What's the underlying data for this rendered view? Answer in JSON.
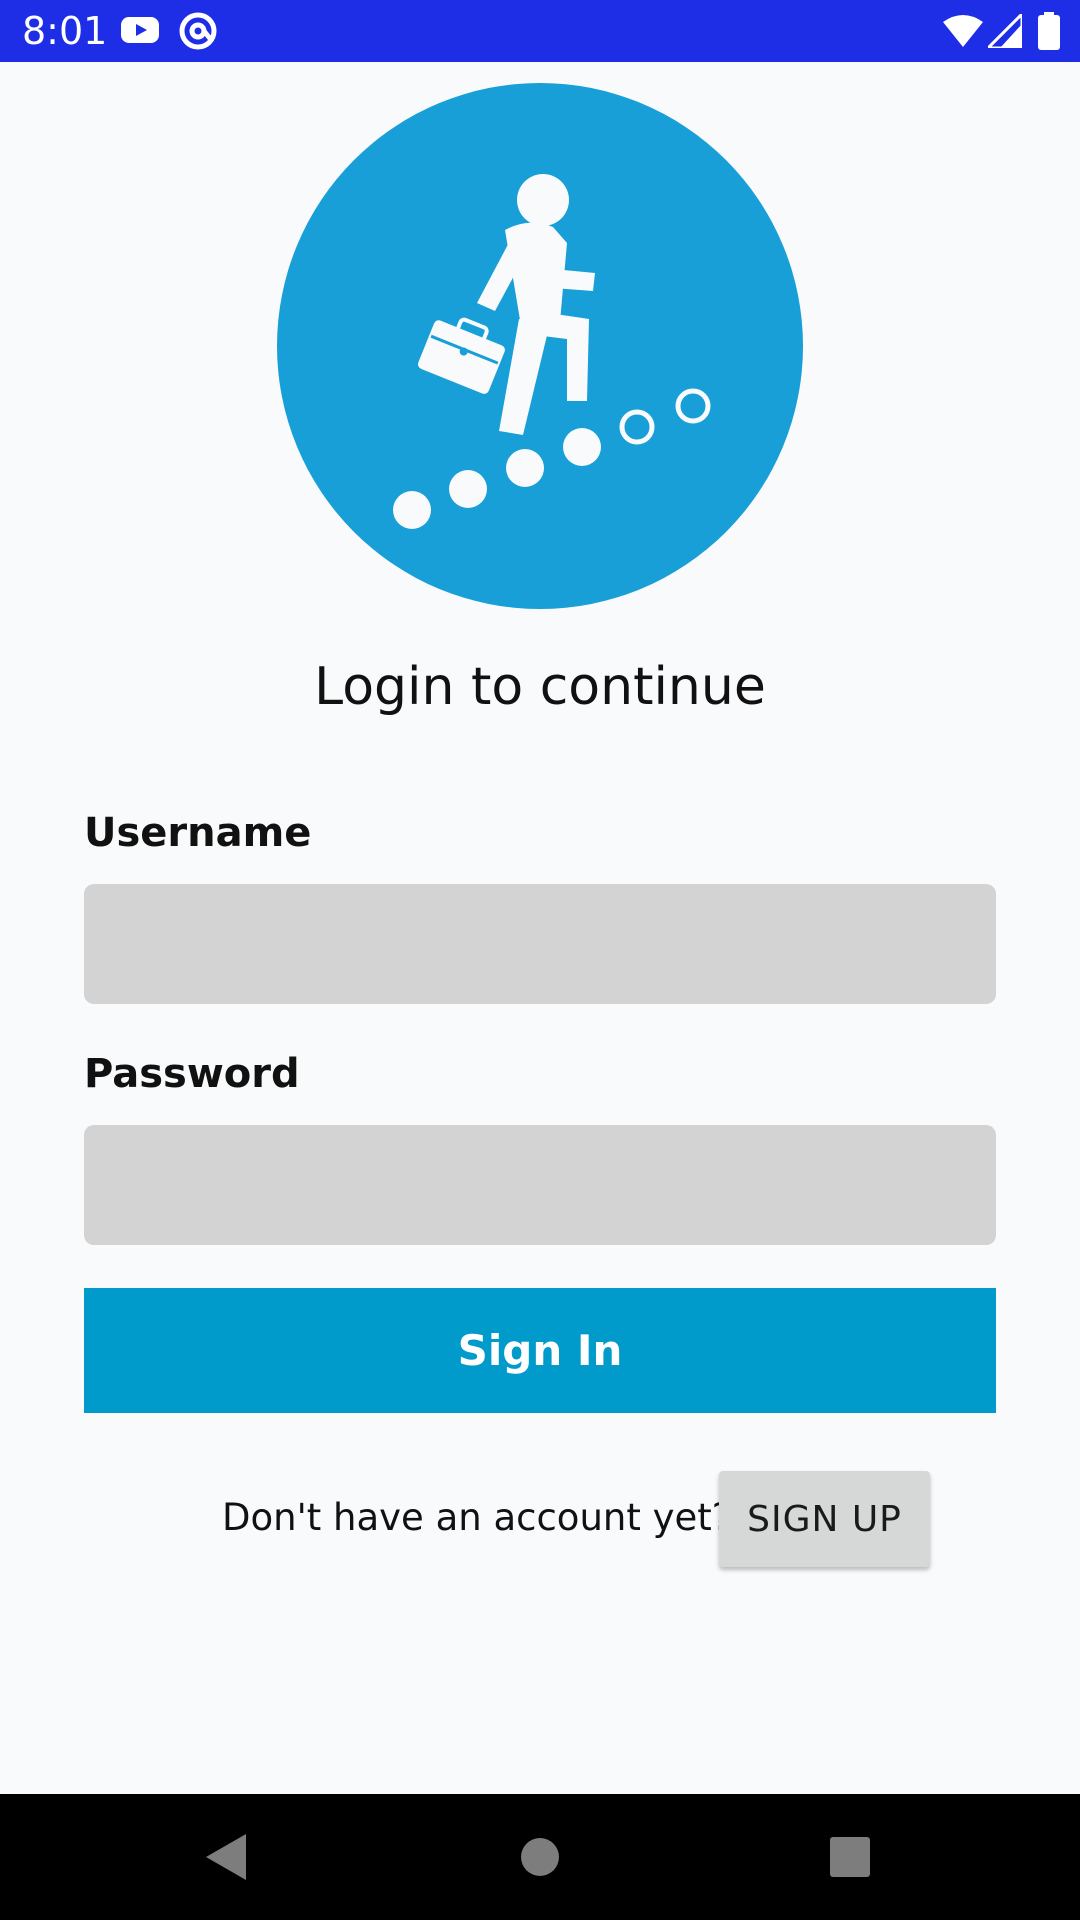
{
  "status_bar": {
    "time": "8:01",
    "background": "#1e2de6",
    "icons": [
      "youtube-icon",
      "at-sign-icon",
      "wifi-icon",
      "signal-icon",
      "battery-icon"
    ]
  },
  "logo": {
    "icon": "career-steps-logo-icon",
    "circle_color": "#189fd7"
  },
  "page": {
    "title": "Login to continue"
  },
  "form": {
    "username_label": "Username",
    "username_value": "",
    "password_label": "Password",
    "password_value": "",
    "field_color": "#d3d3d4"
  },
  "actions": {
    "sign_in_label": "Sign In",
    "sign_in_color": "#009acb",
    "signup_prompt": "Don't have an account yet?",
    "signup_label": "SIGN UP"
  },
  "nav_bar": {
    "icons": [
      "back-icon",
      "home-icon",
      "recents-icon"
    ]
  }
}
